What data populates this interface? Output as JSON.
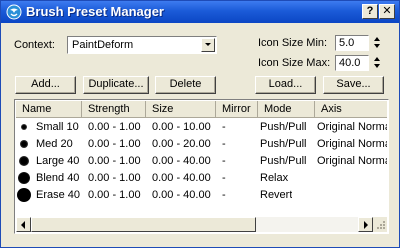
{
  "window": {
    "title": "Brush Preset Manager",
    "help_glyph": "?",
    "close_glyph": "✕"
  },
  "context": {
    "label": "Context:",
    "value": "PaintDeform"
  },
  "icon_size_min": {
    "label": "Icon Size Min:",
    "value": "5.0"
  },
  "icon_size_max": {
    "label": "Icon Size Max:",
    "value": "40.0"
  },
  "buttons": {
    "add": "Add...",
    "duplicate": "Duplicate...",
    "delete": "Delete",
    "load": "Load...",
    "save": "Save..."
  },
  "table": {
    "columns": [
      "Name",
      "Strength",
      "Size",
      "Mirror",
      "Mode",
      "Axis"
    ],
    "rows": [
      {
        "name": "Small 10",
        "strength": "0.00 - 1.00",
        "size": "0.00 - 10.00",
        "mirror": "-",
        "mode": "Push/Pull",
        "axis": "Original Normals"
      },
      {
        "name": "Med 20",
        "strength": "0.00 - 1.00",
        "size": "0.00 - 20.00",
        "mirror": "-",
        "mode": "Push/Pull",
        "axis": "Original Normals"
      },
      {
        "name": "Large 40",
        "strength": "0.00 - 1.00",
        "size": "0.00 - 40.00",
        "mirror": "-",
        "mode": "Push/Pull",
        "axis": "Original Normals"
      },
      {
        "name": "Blend 40",
        "strength": "0.00 - 1.00",
        "size": "0.00 - 40.00",
        "mirror": "-",
        "mode": "Relax",
        "axis": ""
      },
      {
        "name": "Erase 40",
        "strength": "0.00 - 1.00",
        "size": "0.00 - 40.00",
        "mirror": "-",
        "mode": "Revert",
        "axis": ""
      }
    ]
  },
  "colors": {
    "titlebar": "#0b46c4",
    "face": "#ece9d8",
    "list_bg": "#ffffff"
  }
}
